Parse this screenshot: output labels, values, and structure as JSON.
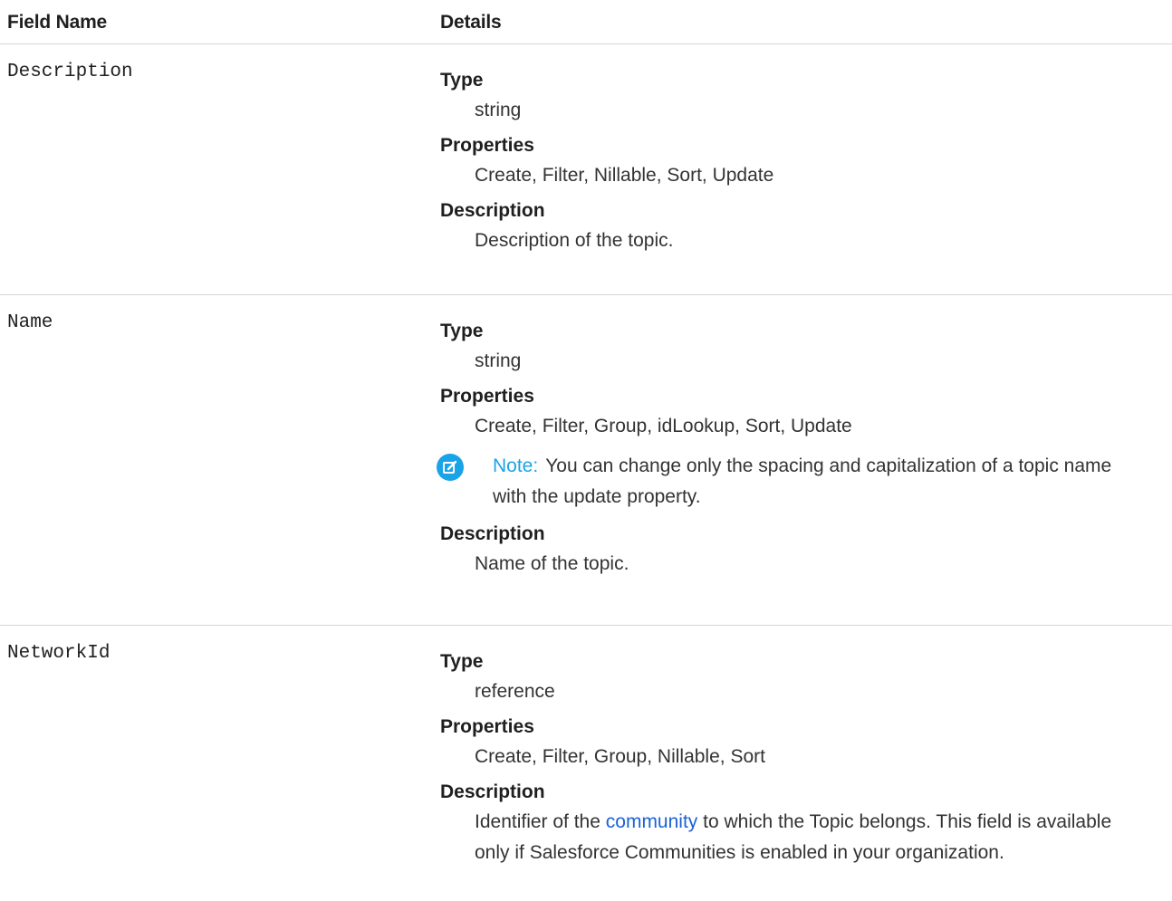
{
  "header": {
    "field_name": "Field Name",
    "details": "Details"
  },
  "rows": [
    {
      "field_name": "Description",
      "type_label": "Type",
      "type_value": "string",
      "properties_label": "Properties",
      "properties_value": "Create, Filter, Nillable, Sort, Update",
      "description_label": "Description",
      "description_value": "Description of the topic."
    },
    {
      "field_name": "Name",
      "type_label": "Type",
      "type_value": "string",
      "properties_label": "Properties",
      "properties_value": "Create, Filter, Group, idLookup, Sort, Update",
      "note_label": "Note:",
      "note_text": "You can change only the spacing and capitalization of a topic name with the update property.",
      "note_icon": "edit-note-icon",
      "description_label": "Description",
      "description_value": "Name of the topic."
    },
    {
      "field_name": "NetworkId",
      "type_label": "Type",
      "type_value": "reference",
      "properties_label": "Properties",
      "properties_value": "Create, Filter, Group, Nillable, Sort",
      "description_label": "Description",
      "description_prefix": "Identifier of the ",
      "description_link": "community",
      "description_suffix": " to which the Topic belongs. This field is available only if Salesforce Communities is enabled in your organization."
    }
  ],
  "colors": {
    "note_accent": "#1ba3e8",
    "link": "#1a62d6",
    "divider": "#d6d6d6"
  }
}
